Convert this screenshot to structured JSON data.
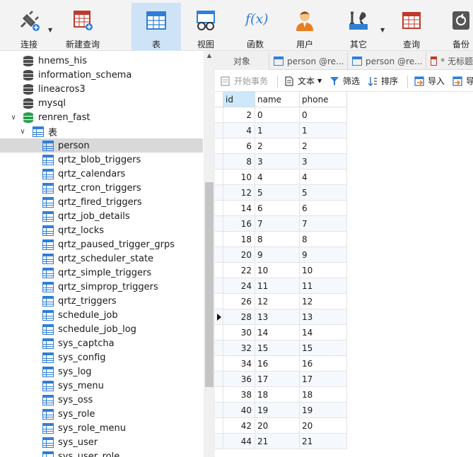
{
  "toolbar": {
    "items": [
      {
        "label": "连接",
        "icon": "plug-icon"
      },
      {
        "label": "新建查询",
        "icon": "new-query-icon"
      },
      {
        "label": "表",
        "icon": "table-icon"
      },
      {
        "label": "视图",
        "icon": "view-icon"
      },
      {
        "label": "函数",
        "icon": "function-icon"
      },
      {
        "label": "用户",
        "icon": "user-icon"
      },
      {
        "label": "其它",
        "icon": "tools-icon"
      },
      {
        "label": "查询",
        "icon": "query-icon"
      },
      {
        "label": "备份",
        "icon": "backup-icon"
      }
    ],
    "function_glyph": "f(x)"
  },
  "sidebar": {
    "databases": [
      {
        "label": "hnems_his"
      },
      {
        "label": "information_schema"
      },
      {
        "label": "lineacros3"
      },
      {
        "label": "mysql"
      }
    ],
    "active_db": "renren_fast",
    "tables_group": "表",
    "tables": [
      "person",
      "qrtz_blob_triggers",
      "qrtz_calendars",
      "qrtz_cron_triggers",
      "qrtz_fired_triggers",
      "qrtz_job_details",
      "qrtz_locks",
      "qrtz_paused_trigger_grps",
      "qrtz_scheduler_state",
      "qrtz_simple_triggers",
      "qrtz_simprop_triggers",
      "qrtz_triggers",
      "schedule_job",
      "schedule_job_log",
      "sys_captcha",
      "sys_config",
      "sys_log",
      "sys_menu",
      "sys_oss",
      "sys_role",
      "sys_role_menu",
      "sys_user",
      "sys_user_role"
    ]
  },
  "tabs": [
    {
      "label": "对象"
    },
    {
      "label": "person @re..."
    },
    {
      "label": "person @re..."
    },
    {
      "label": "* 无标题"
    }
  ],
  "toolbar2": {
    "begin_transaction": "开始事务",
    "text": "文本",
    "filter": "筛选",
    "sort": "排序",
    "import": "导入",
    "export": "导"
  },
  "grid": {
    "columns": [
      "id",
      "name",
      "phone"
    ],
    "rows": [
      [
        "2",
        "0",
        "0"
      ],
      [
        "4",
        "1",
        "1"
      ],
      [
        "6",
        "2",
        "2"
      ],
      [
        "8",
        "3",
        "3"
      ],
      [
        "10",
        "4",
        "4"
      ],
      [
        "12",
        "5",
        "5"
      ],
      [
        "14",
        "6",
        "6"
      ],
      [
        "16",
        "7",
        "7"
      ],
      [
        "18",
        "8",
        "8"
      ],
      [
        "20",
        "9",
        "9"
      ],
      [
        "22",
        "10",
        "10"
      ],
      [
        "24",
        "11",
        "11"
      ],
      [
        "26",
        "12",
        "12"
      ],
      [
        "28",
        "13",
        "13"
      ],
      [
        "30",
        "14",
        "14"
      ],
      [
        "32",
        "15",
        "15"
      ],
      [
        "34",
        "16",
        "16"
      ],
      [
        "36",
        "17",
        "17"
      ],
      [
        "38",
        "18",
        "18"
      ],
      [
        "40",
        "19",
        "19"
      ],
      [
        "42",
        "20",
        "20"
      ],
      [
        "44",
        "21",
        "21"
      ]
    ],
    "current_row": 13
  },
  "colors": {
    "accent": "#2f7ed8",
    "selected_tab": "#cfe3f6",
    "db_active": "#23a04a"
  }
}
